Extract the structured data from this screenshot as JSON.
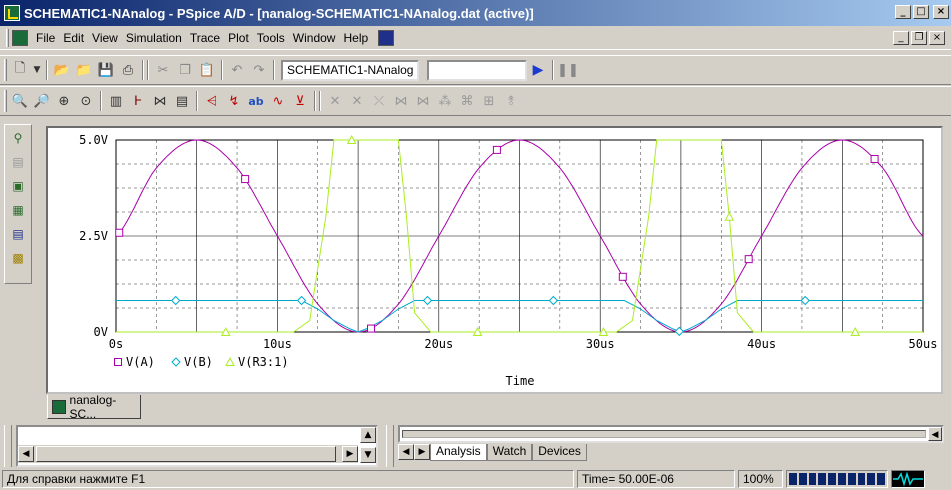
{
  "window": {
    "title": "SCHEMATIC1-NAnalog - PSpice A/D - [nanalog-SCHEMATIC1-NAnalog.dat (active)]",
    "minimize_glyph": "_",
    "maximize_glyph": "□",
    "close_glyph": "×",
    "restore_glyph": "❐"
  },
  "menu": {
    "items": [
      "File",
      "Edit",
      "View",
      "Simulation",
      "Trace",
      "Plot",
      "Tools",
      "Window",
      "Help"
    ]
  },
  "toolbar": {
    "profile_select": "SCHEMATIC1-NAnalog",
    "search_value": ""
  },
  "icons": {
    "new": "new-icon",
    "open": "open-icon",
    "save": "save-icon",
    "print": "print-icon",
    "cut": "cut-icon",
    "copy": "copy-icon",
    "paste": "paste-icon",
    "undo": "undo-icon",
    "redo": "redo-icon",
    "run": "run-icon",
    "pause": "pause-icon"
  },
  "plot": {
    "y_ticks": [
      "5.0V",
      "2.5V",
      "0V"
    ],
    "x_ticks": [
      "0s",
      "10us",
      "20us",
      "30us",
      "40us",
      "50us"
    ],
    "x_title": "Time"
  },
  "chart_data": {
    "type": "line",
    "x_unit": "us",
    "xlim": [
      0,
      50
    ],
    "ylim": [
      0,
      5
    ],
    "grid": true,
    "legend_placement": "bottom-left",
    "series": [
      {
        "name": "V(A)",
        "color": "#aa00aa",
        "marker": "square",
        "x": [
          0,
          2.5,
          5,
          7.5,
          10,
          12.5,
          15,
          17.5,
          20,
          22.5,
          25,
          27.5,
          30,
          32.5,
          35,
          37.5,
          40,
          42.5,
          45,
          47.5,
          50
        ],
        "y": [
          2.5,
          4.27,
          5.0,
          4.27,
          2.5,
          0.73,
          0.0,
          0.73,
          2.5,
          4.27,
          5.0,
          4.27,
          2.5,
          0.73,
          0.0,
          0.73,
          2.5,
          4.27,
          5.0,
          4.27,
          2.5
        ]
      },
      {
        "name": "V(B)",
        "color": "#00aacc",
        "marker": "diamond",
        "x": [
          0,
          11.5,
          12.5,
          13.5,
          14.5,
          15,
          15.5,
          16.5,
          17.5,
          18.5,
          31.5,
          32.5,
          33.5,
          34.5,
          35,
          35.5,
          36.5,
          37.5,
          38.5,
          50
        ],
        "y": [
          0.82,
          0.82,
          0.6,
          0.3,
          0.08,
          0.0,
          0.08,
          0.3,
          0.6,
          0.82,
          0.82,
          0.6,
          0.3,
          0.08,
          0.0,
          0.08,
          0.3,
          0.6,
          0.82,
          0.82
        ]
      },
      {
        "name": "V(R3:1)",
        "color": "#aaee22",
        "marker": "triangle",
        "x": [
          0,
          11.0,
          12.0,
          13.0,
          13.5,
          17.5,
          18.0,
          18.5,
          19.5,
          31.0,
          32.0,
          33.0,
          33.5,
          37.5,
          38.0,
          38.5,
          39.5,
          50
        ],
        "y": [
          0.0,
          0.0,
          0.3,
          3.0,
          5.0,
          5.0,
          3.0,
          0.5,
          0.0,
          0.0,
          0.3,
          3.0,
          5.0,
          5.0,
          3.0,
          0.5,
          0.0,
          0.0
        ]
      }
    ]
  },
  "window_tab": {
    "label": "nanalog-SC..."
  },
  "output_tabs": [
    "Analysis",
    "Watch",
    "Devices"
  ],
  "status": {
    "help": "Для справки нажмите F1",
    "time": "Time= 50.00E-06",
    "zoom": "100%"
  }
}
